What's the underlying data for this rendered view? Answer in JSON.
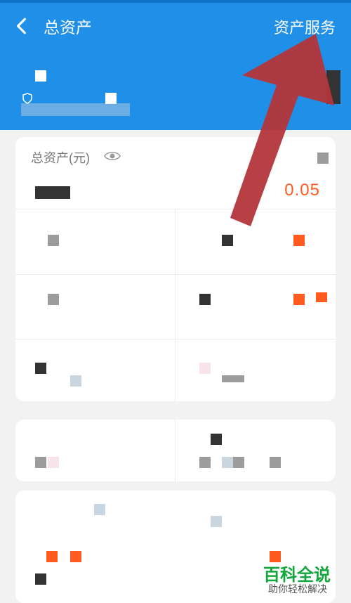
{
  "header": {
    "title": "总资产",
    "right_action": "资产服务"
  },
  "card": {
    "label": "总资产(元)",
    "orange_value": "0.05"
  },
  "icons": {
    "back": "chevron-left-icon",
    "eye": "eye-icon"
  },
  "watermark": {
    "title": "百科全说",
    "subtitle": "助你轻松解决"
  },
  "colors": {
    "header": "#1f8fe8",
    "accent": "#ff5a1f",
    "background": "#f2f2f2",
    "watermark": "#11a53b"
  }
}
